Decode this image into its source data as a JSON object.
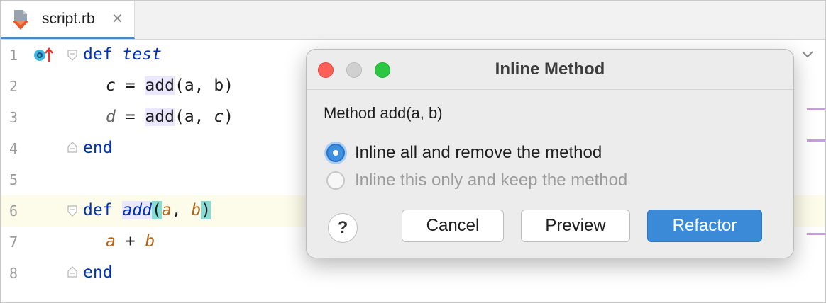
{
  "tab": {
    "filename": "script.rb",
    "close_glyph": "✕"
  },
  "editor": {
    "line_numbers": [
      "1",
      "2",
      "3",
      "4",
      "5",
      "6",
      "7",
      "8"
    ],
    "line1": {
      "kw": "def",
      "name": "test"
    },
    "line2": {
      "var": "c",
      "eq": " = ",
      "call": "add",
      "open": "(",
      "args": "a, b",
      "close": ")"
    },
    "line3": {
      "var": "d",
      "eq": " = ",
      "call": "add",
      "open": "(",
      "arg1": "a, ",
      "arg2": "c",
      "close": ")"
    },
    "line4": {
      "kw": "end"
    },
    "line6": {
      "kw": "def",
      "name": "add",
      "open": "(",
      "p1": "a",
      "comma": ", ",
      "p2": "b",
      "close": ")"
    },
    "line7": {
      "a": "a",
      "op": " + ",
      "b": "b"
    },
    "line8": {
      "kw": "end"
    },
    "current_line_color": "#fdfbe9"
  },
  "dialog": {
    "title": "Inline Method",
    "method_label": "Method add(a, b)",
    "options": [
      {
        "label": "Inline all and remove the method",
        "selected": true
      },
      {
        "label": "Inline this only and keep the method",
        "selected": false,
        "disabled": true
      }
    ],
    "help_glyph": "?",
    "buttons": {
      "cancel": "Cancel",
      "preview": "Preview",
      "refactor": "Refactor"
    },
    "traffic_lights": {
      "close": "#fe5f57",
      "minimize": "#d0d0d0",
      "zoom": "#2ac840"
    },
    "accent": "#3a8ad8"
  }
}
